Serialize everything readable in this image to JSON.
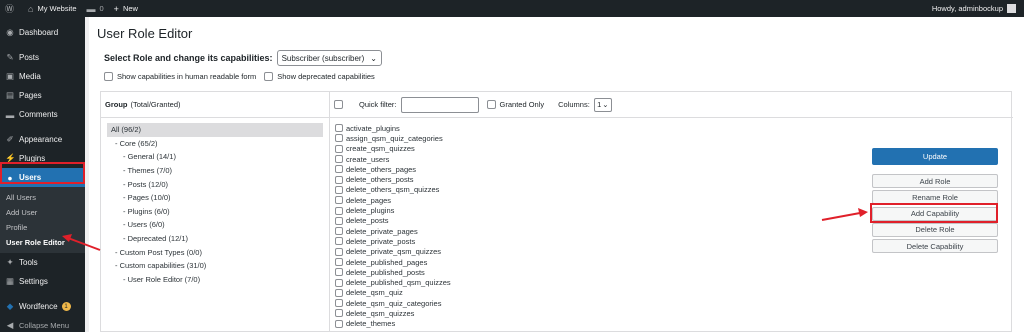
{
  "admin_bar": {
    "site_name": "My Website",
    "comments_count": "0",
    "new_label": "New",
    "howdy": "Howdy, adminbockup"
  },
  "sidebar": {
    "items": [
      {
        "label": "Dashboard",
        "icon": "dashboard-icon",
        "glyph": "◉"
      },
      {
        "label": "Posts",
        "icon": "pin-icon",
        "glyph": "✎"
      },
      {
        "label": "Media",
        "icon": "media-icon",
        "glyph": "▣"
      },
      {
        "label": "Pages",
        "icon": "pages-icon",
        "glyph": "▤"
      },
      {
        "label": "Comments",
        "icon": "comments-icon",
        "glyph": "▬"
      },
      {
        "label": "Appearance",
        "icon": "appearance-icon",
        "glyph": "✐"
      },
      {
        "label": "Plugins",
        "icon": "plugins-icon",
        "glyph": "⚡"
      },
      {
        "label": "Users",
        "icon": "users-icon",
        "glyph": "●"
      },
      {
        "label": "Tools",
        "icon": "tools-icon",
        "glyph": "✦"
      },
      {
        "label": "Settings",
        "icon": "settings-icon",
        "glyph": "▦"
      },
      {
        "label": "Wordfence",
        "icon": "wordfence-icon",
        "glyph": "◆",
        "badge": "1"
      },
      {
        "label": "Collapse Menu",
        "icon": "collapse-icon",
        "glyph": "◀"
      }
    ],
    "users_submenu": [
      "All Users",
      "Add User",
      "Profile",
      "User Role Editor"
    ]
  },
  "page": {
    "title": "User Role Editor",
    "select_role_label": "Select Role and change its capabilities:",
    "selected_role": "Subscriber (subscriber)",
    "opt_human_readable": "Show capabilities in human readable form",
    "opt_deprecated": "Show deprecated capabilities"
  },
  "groups": {
    "header_bold": "Group",
    "header_rest": "(Total/Granted)",
    "items": [
      {
        "label": "All (96/2)",
        "level": 0
      },
      {
        "label": "- Core (65/2)",
        "level": 1
      },
      {
        "label": "- General (14/1)",
        "level": 2
      },
      {
        "label": "- Themes (7/0)",
        "level": 2
      },
      {
        "label": "- Posts (12/0)",
        "level": 2
      },
      {
        "label": "- Pages (10/0)",
        "level": 2
      },
      {
        "label": "- Plugins (6/0)",
        "level": 2
      },
      {
        "label": "- Users (6/0)",
        "level": 2
      },
      {
        "label": "- Deprecated (12/1)",
        "level": 2
      },
      {
        "label": "- Custom Post Types (0/0)",
        "level": 1
      },
      {
        "label": "- Custom capabilities (31/0)",
        "level": 1
      },
      {
        "label": "- User Role Editor (7/0)",
        "level": 2
      }
    ]
  },
  "caps": {
    "quick_filter_label": "Quick filter:",
    "granted_only_label": "Granted Only",
    "columns_label": "Columns:",
    "columns_value": "1",
    "items": [
      "activate_plugins",
      "assign_qsm_quiz_categories",
      "create_qsm_quizzes",
      "create_users",
      "delete_others_pages",
      "delete_others_posts",
      "delete_others_qsm_quizzes",
      "delete_pages",
      "delete_plugins",
      "delete_posts",
      "delete_private_pages",
      "delete_private_posts",
      "delete_private_qsm_quizzes",
      "delete_published_pages",
      "delete_published_posts",
      "delete_published_qsm_quizzes",
      "delete_qsm_quiz",
      "delete_qsm_quiz_categories",
      "delete_qsm_quizzes",
      "delete_themes"
    ]
  },
  "actions": {
    "update": "Update",
    "add_role": "Add Role",
    "rename_role": "Rename Role",
    "add_capability": "Add Capability",
    "delete_role": "Delete Role",
    "delete_capability": "Delete Capability"
  },
  "colors": {
    "admin_dark": "#1d2327",
    "wp_blue": "#2271b1",
    "highlight_red": "#e0202a"
  }
}
